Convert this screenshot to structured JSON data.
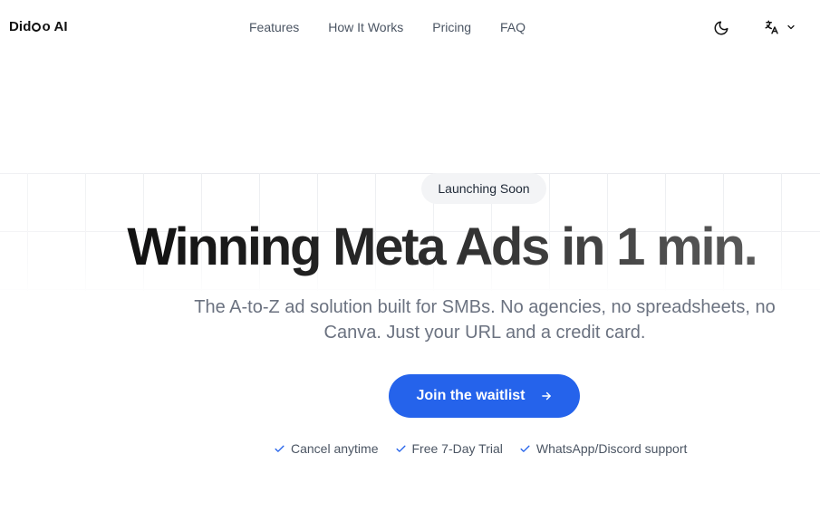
{
  "nav": {
    "logo_pre": "Did",
    "logo_post": "o AI",
    "links": [
      "Features",
      "How It Works",
      "Pricing",
      "FAQ"
    ],
    "theme_icon": "moon-icon",
    "language_icon": "translate-icon"
  },
  "hero": {
    "badge": "Launching Soon",
    "headline": "Winning Meta Ads in 1 min.",
    "subtitle": "The A-to-Z ad solution built for SMBs. No agencies, no spreadsheets, no Canva. Just your URL and a credit card.",
    "cta_label": "Join the waitlist",
    "perks": [
      "Cancel anytime",
      "Free 7-Day Trial",
      "WhatsApp/Discord support"
    ]
  },
  "colors": {
    "accent": "#2563eb",
    "text_dark": "#111827",
    "text_muted": "#6b7280",
    "check": "#2563eb"
  }
}
